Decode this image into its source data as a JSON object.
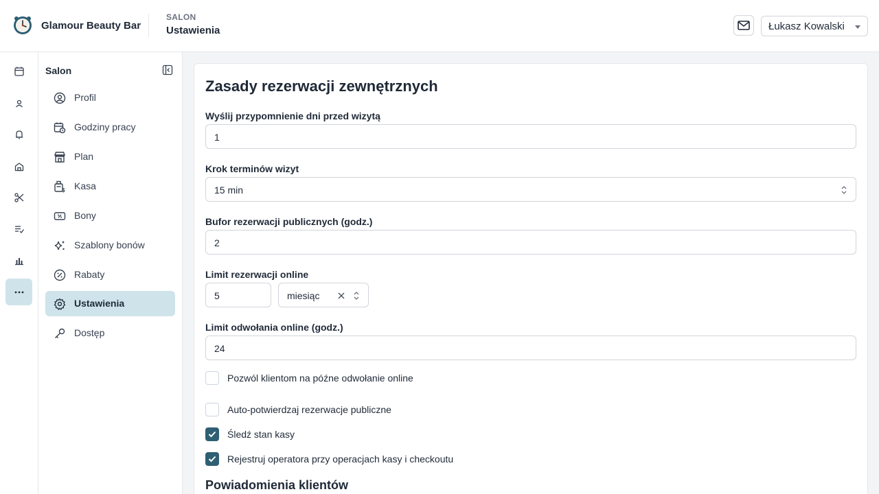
{
  "header": {
    "brand": "Glamour Beauty Bar",
    "breadcrumb_section": "SALON",
    "breadcrumb_page": "Ustawienia",
    "user_name": "Łukasz Kowalski"
  },
  "rail": {
    "items": [
      {
        "icon": "calendar-icon"
      },
      {
        "icon": "users-icon"
      },
      {
        "icon": "bell-icon"
      },
      {
        "icon": "building-icon"
      },
      {
        "icon": "scissors-icon"
      },
      {
        "icon": "checklist-icon"
      },
      {
        "icon": "bar-chart-icon"
      },
      {
        "icon": "more-icon",
        "active": true
      }
    ]
  },
  "subnav": {
    "title": "Salon",
    "items": [
      {
        "label": "Profil",
        "icon": "user-circle-icon"
      },
      {
        "label": "Godziny pracy",
        "icon": "calendar-clock-icon"
      },
      {
        "label": "Plan",
        "icon": "store-icon"
      },
      {
        "label": "Kasa",
        "icon": "cash-register-icon"
      },
      {
        "label": "Bony",
        "icon": "voucher-icon"
      },
      {
        "label": "Szablony bonów",
        "icon": "sparkles-icon"
      },
      {
        "label": "Rabaty",
        "icon": "discount-icon"
      },
      {
        "label": "Ustawienia",
        "icon": "settings-icon",
        "active": true
      },
      {
        "label": "Dostęp",
        "icon": "key-icon"
      }
    ]
  },
  "main": {
    "title": "Zasady rezerwacji zewnętrznych",
    "reminder": {
      "label": "Wyślij przypomnienie dni przed wizytą",
      "value": "1"
    },
    "slot_step": {
      "label": "Krok terminów wizyt",
      "value": "15 min"
    },
    "buffer": {
      "label": "Bufor rezerwacji publicznych (godz.)",
      "value": "2"
    },
    "online_limit": {
      "label": "Limit rezerwacji online",
      "value": "5",
      "period": "miesiąc"
    },
    "cancel_limit": {
      "label": "Limit odwołania online (godz.)",
      "value": "24"
    },
    "checkboxes": [
      {
        "label": "Pozwól klientom na późne odwołanie online",
        "checked": false
      },
      {
        "label": "Auto-potwierdzaj rezerwacje publiczne",
        "checked": false
      },
      {
        "label": "Śledź stan kasy",
        "checked": true
      },
      {
        "label": "Rejestruj operatora przy operacjach kasy i checkoutu",
        "checked": true
      }
    ],
    "next_section": "Powiadomienia klientów"
  },
  "colors": {
    "accent": "#2e5f73",
    "active_bg": "#cfe3ea"
  }
}
